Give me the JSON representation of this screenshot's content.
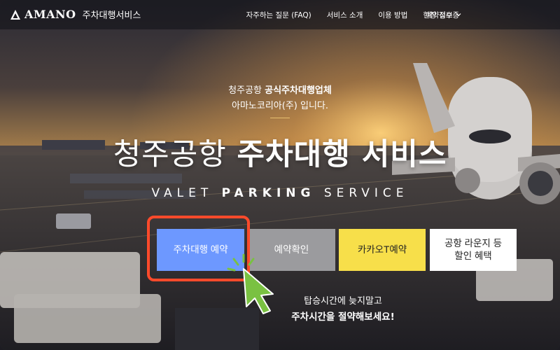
{
  "header": {
    "brand": "AMANO",
    "service_name": "주차대행서비스",
    "nav": [
      {
        "label": "자주하는 질문 (FAQ)"
      },
      {
        "label": "서비스 소개"
      },
      {
        "label": "이용 방법"
      },
      {
        "label": "현장 접수증"
      }
    ],
    "dropdown_label": "예약정보"
  },
  "hero": {
    "intro_line1_prefix": "청주공항 ",
    "intro_line1_bold": "공식주차대행업체",
    "intro_line2": "아마노코리아(주) 입니다.",
    "headline_regular": "청주공항 ",
    "headline_bold": "주차대행 서비스",
    "sub_1": "VALET ",
    "sub_2": "PARKING",
    "sub_3": " SERVICE"
  },
  "buttons": {
    "reserve": "주차대행 예약",
    "check": "예약확인",
    "kakao": "카카오T예약",
    "lounge_line1": "공항 라운지 등",
    "lounge_line2": "할인 혜택"
  },
  "tagline": {
    "line1": "탑승시간에 늦지말고",
    "line2": "주차시간을 절약해보세요!"
  },
  "icons": {
    "logo": "amano-triangle-logo",
    "dropdown": "chevron-down-icon",
    "cursor": "pointer-cursor-icon"
  },
  "colors": {
    "reserve_button": "#6d98ff",
    "check_button": "#9b9b9e",
    "kakao_button": "#f7df4a",
    "lounge_button": "#ffffff",
    "highlight_box": "#ff4a2b",
    "cursor": "#7ac142"
  }
}
